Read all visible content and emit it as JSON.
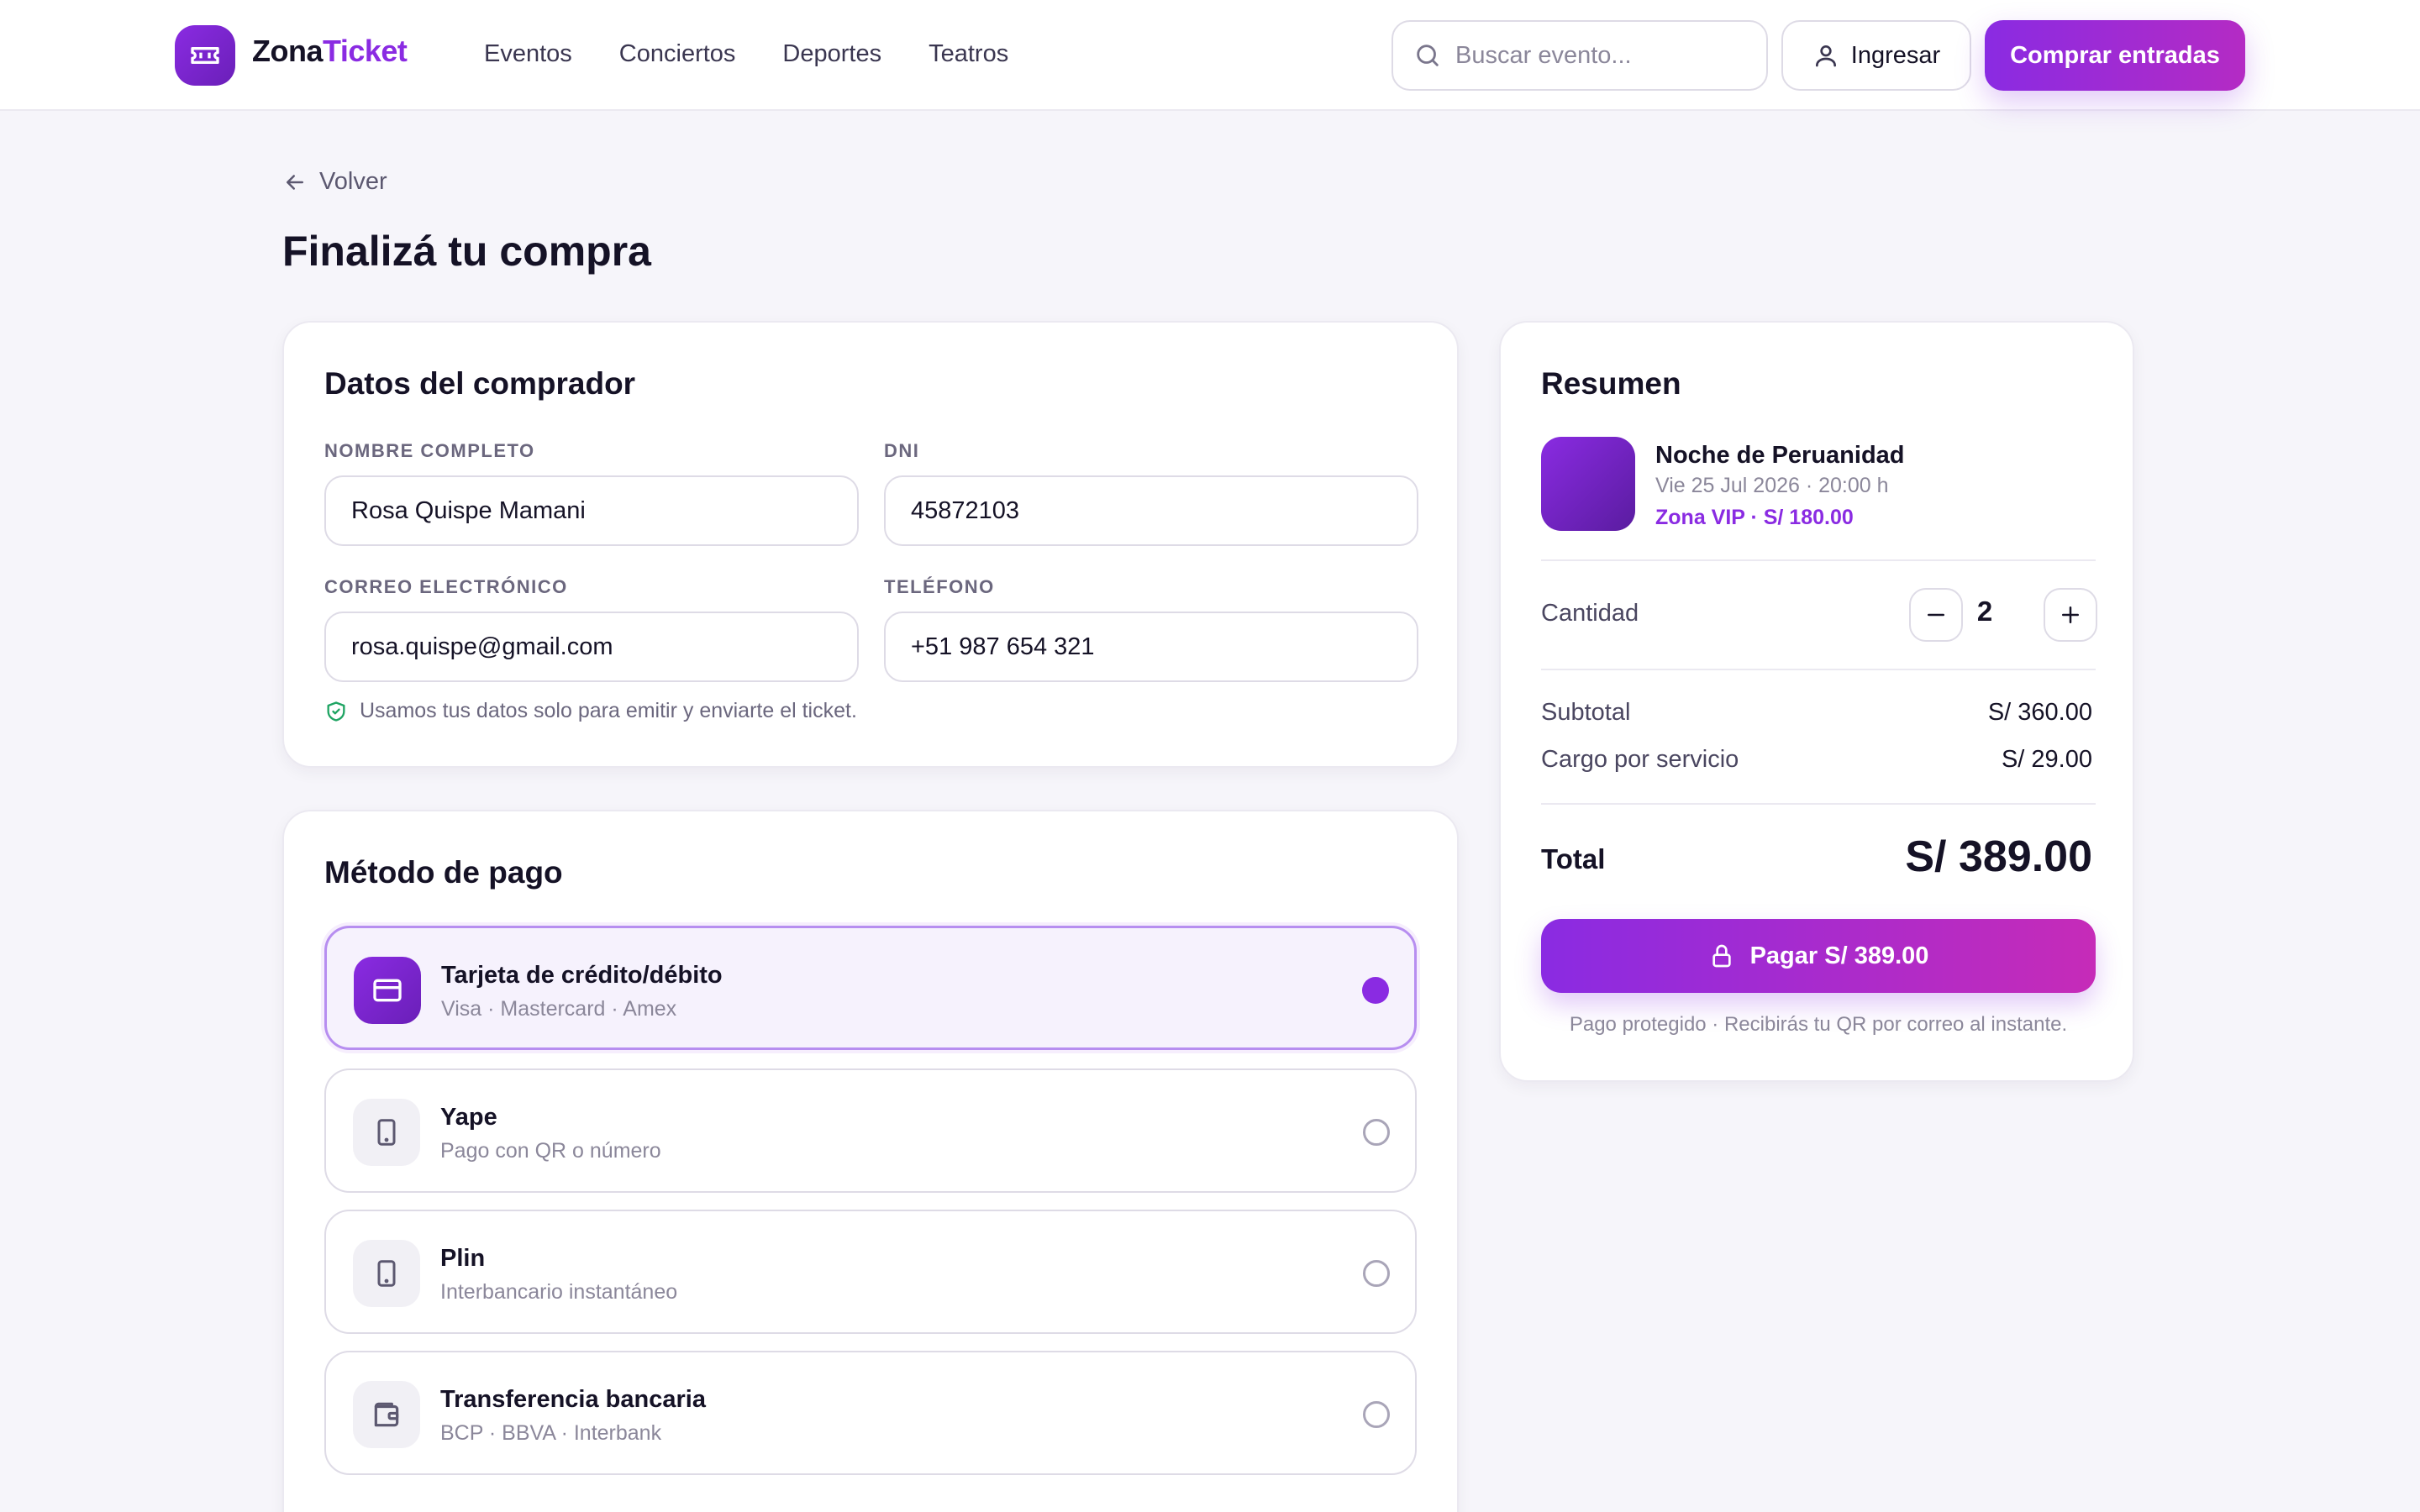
{
  "header": {
    "brand_part1": "Zona",
    "brand_part2": "Ticket",
    "nav": [
      "Eventos",
      "Conciertos",
      "Deportes",
      "Teatros"
    ],
    "search_placeholder": "Buscar evento...",
    "login_label": "Ingresar",
    "buy_label": "Comprar entradas"
  },
  "back_label": "Volver",
  "page_title": "Finalizá tu compra",
  "buyer": {
    "title": "Datos del comprador",
    "name_label": "NOMBRE COMPLETO",
    "name_value": "Rosa Quispe Mamani",
    "dni_label": "DNI",
    "dni_value": "45872103",
    "email_label": "CORREO ELECTRÓNICO",
    "email_value": "rosa.quispe@gmail.com",
    "phone_label": "TELÉFONO",
    "phone_value": "+51 987 654 321",
    "privacy_note": "Usamos tus datos solo para emitir y enviarte el ticket."
  },
  "payment": {
    "title": "Método de pago",
    "options": [
      {
        "name": "Tarjeta de crédito/débito",
        "sub": "Visa · Mastercard · Amex",
        "selected": true,
        "icon": "credit-card-icon"
      },
      {
        "name": "Yape",
        "sub": "Pago con QR o número",
        "selected": false,
        "icon": "smartphone-icon"
      },
      {
        "name": "Plin",
        "sub": "Interbancario instantáneo",
        "selected": false,
        "icon": "smartphone-icon"
      },
      {
        "name": "Transferencia bancaria",
        "sub": "BCP · BBVA · Interbank",
        "selected": false,
        "icon": "wallet-icon"
      }
    ]
  },
  "summary": {
    "title": "Resumen",
    "event_name": "Noche de Peruanidad",
    "event_date": "Vie 25 Jul 2026 · 20:00 h",
    "event_zone": "Zona VIP · S/ 180.00",
    "quantity_label": "Cantidad",
    "quantity": "2",
    "subtotal_label": "Subtotal",
    "subtotal_value": "S/ 360.00",
    "fee_label": "Cargo por servicio",
    "fee_value": "S/ 29.00",
    "total_label": "Total",
    "total_value": "S/ 389.00",
    "pay_button": "Pagar S/ 389.00",
    "note": "Pago protegido · Recibirás tu QR por correo al instante."
  },
  "colors": {
    "accent": "#8a2be2",
    "accent_pink": "#c62bb8",
    "privacy_green": "#1fa463"
  }
}
